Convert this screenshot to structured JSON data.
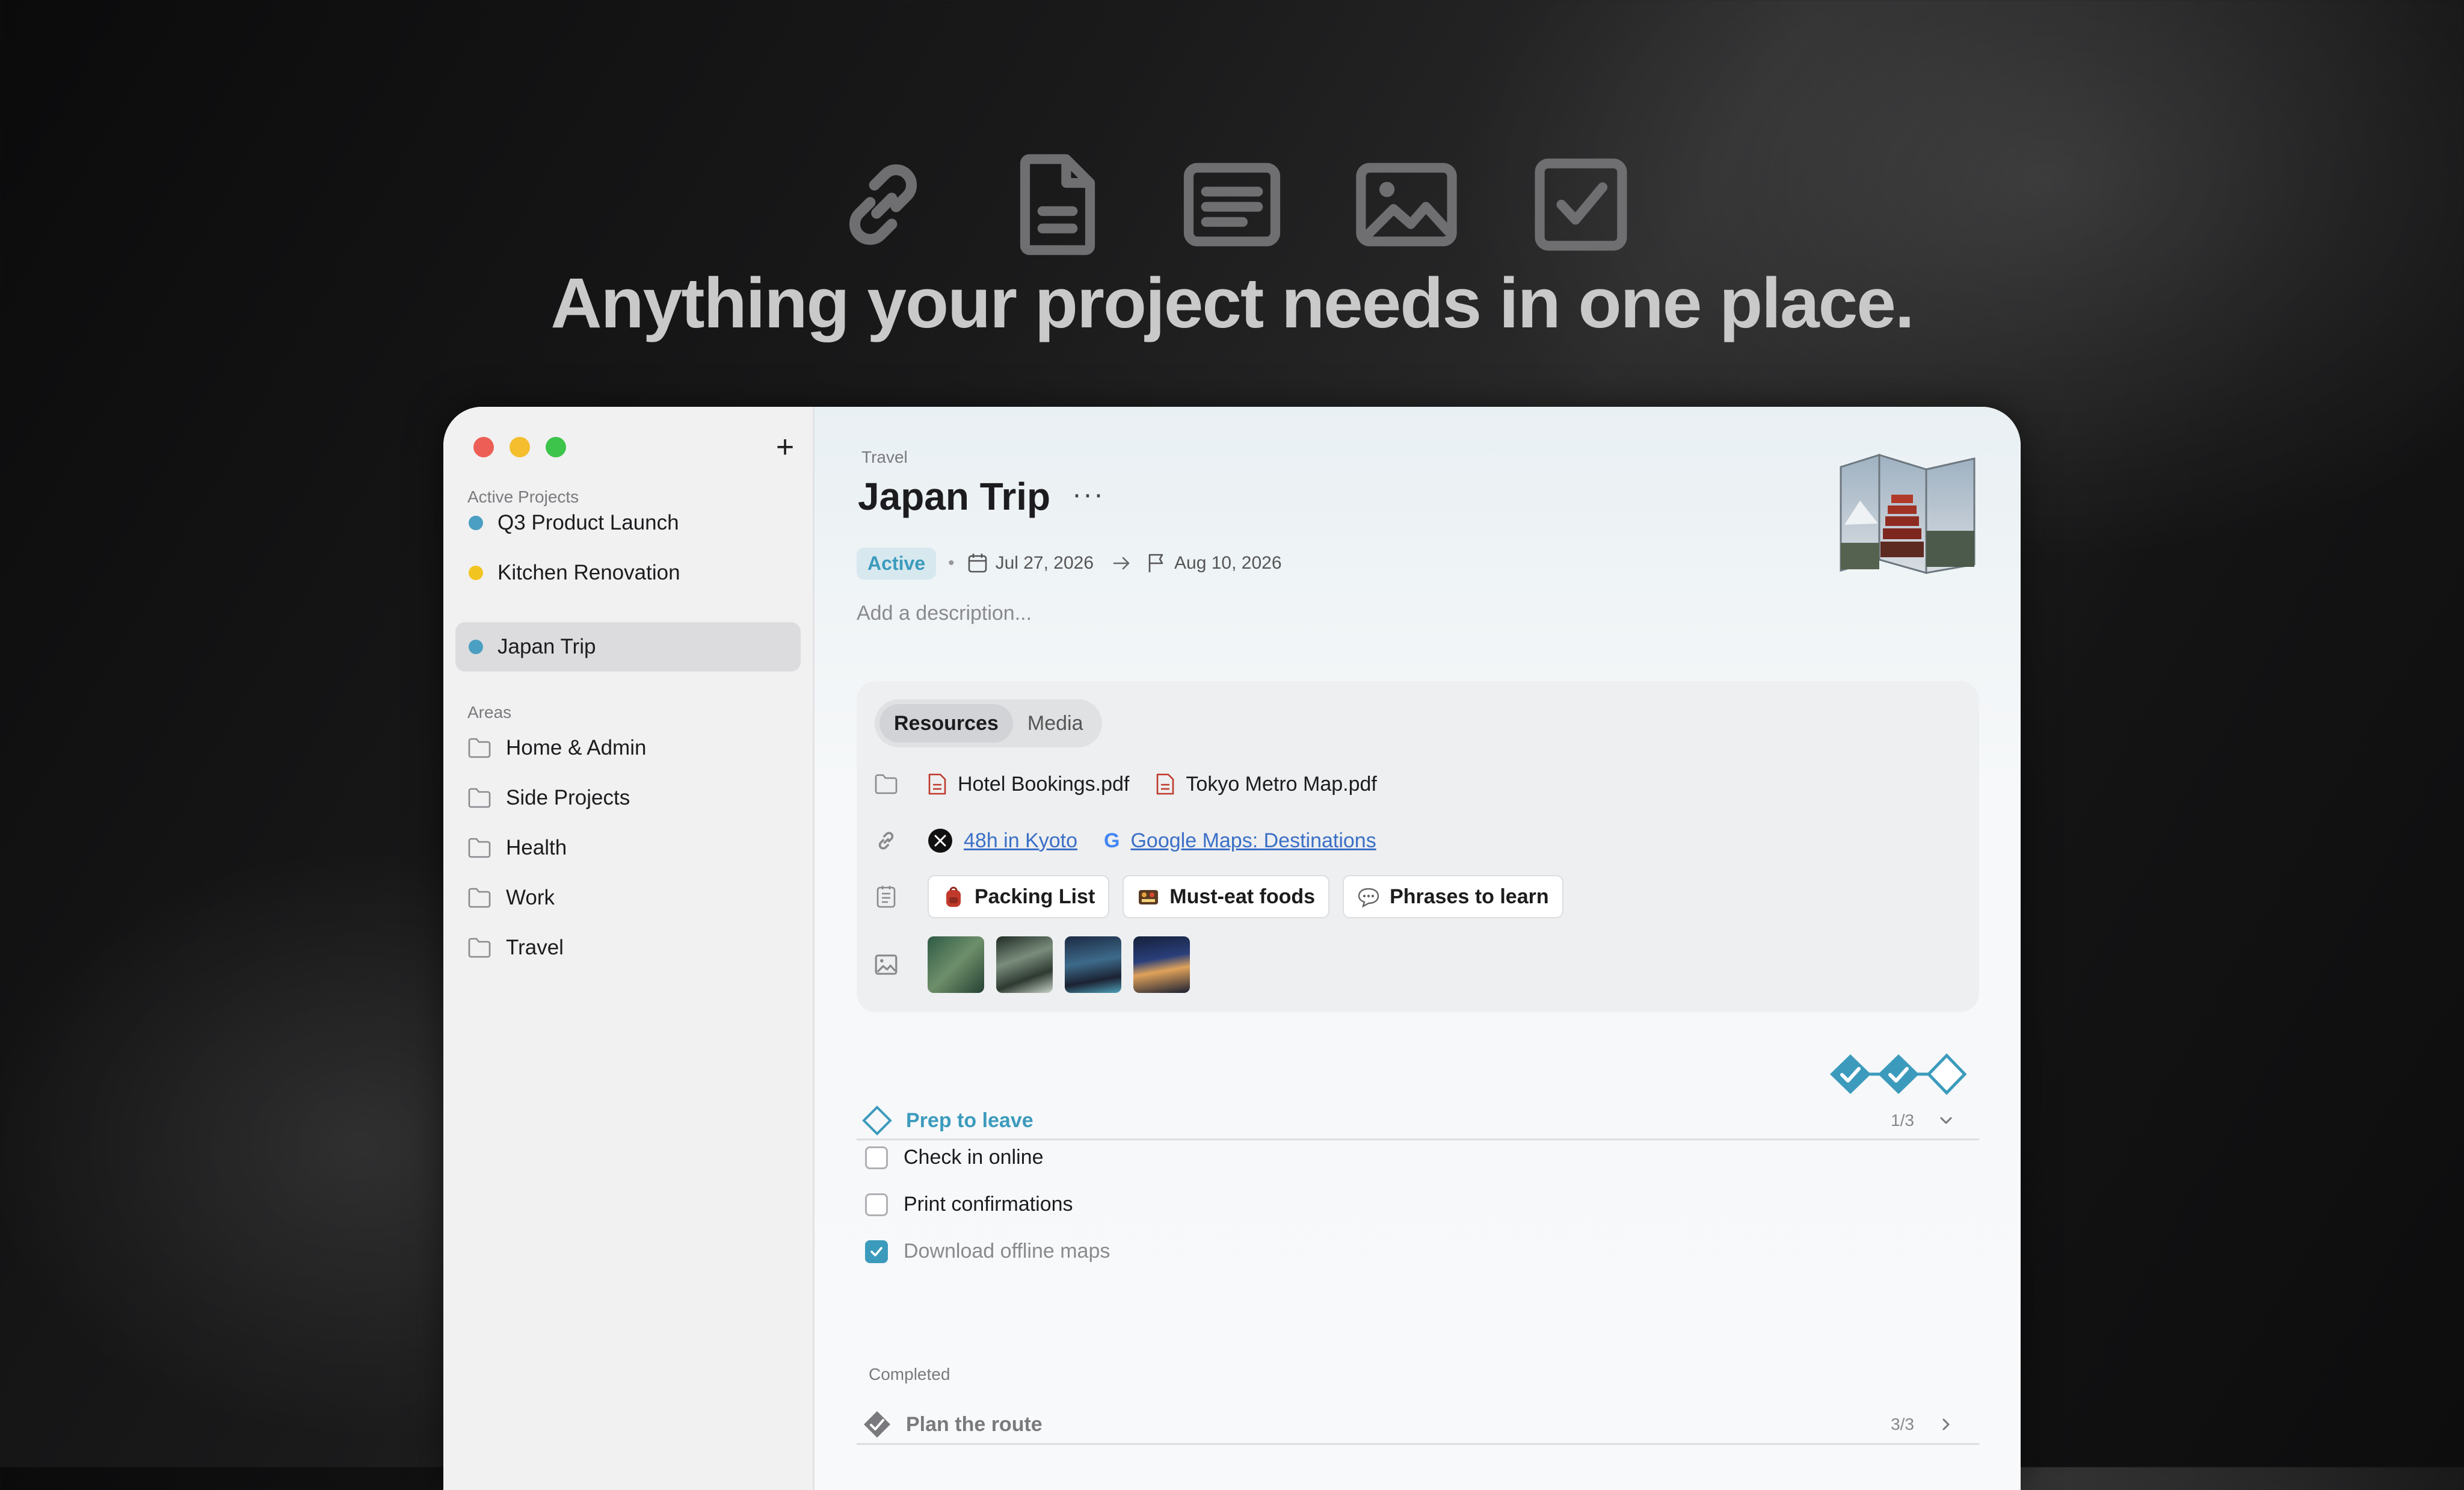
{
  "hero": {
    "icons": [
      "link-icon",
      "document-icon",
      "note-icon",
      "image-icon",
      "checkbox-icon"
    ],
    "headline": "Anything your project needs in one place."
  },
  "colors": {
    "accent": "#3c9bbd",
    "traffic_red": "#ed5f56",
    "traffic_yellow": "#f4be2e",
    "traffic_green": "#3dc44b",
    "link_blue": "#3a6fc7"
  },
  "sidebar": {
    "add_label": "+",
    "active_projects_label": "Active Projects",
    "projects": [
      {
        "label": "Q3 Product Launch",
        "color": "#4b9fc2"
      },
      {
        "label": "Kitchen Renovation",
        "color": "#f2c41f"
      },
      {
        "label": "Japan Trip",
        "color": "#4b9fc2"
      }
    ],
    "areas_label": "Areas",
    "areas": [
      "Home & Admin",
      "Side Projects",
      "Health",
      "Work",
      "Travel"
    ]
  },
  "project": {
    "breadcrumb": "Travel",
    "title": "Japan Trip",
    "more_label": "···",
    "status": "Active",
    "start_date": "Jul 27, 2026",
    "end_date": "Aug 10, 2026",
    "description_placeholder": "Add a description..."
  },
  "resources": {
    "tabs": [
      "Resources",
      "Media"
    ],
    "files": [
      "Hotel Bookings.pdf",
      "Tokyo Metro Map.pdf"
    ],
    "links": [
      "48h in Kyoto",
      "Google Maps: Destinations"
    ],
    "link_icon_letter": "G",
    "notes": [
      "Packing List",
      "Must-eat foods",
      "Phrases to learn"
    ]
  },
  "checklist": {
    "progress_steps": [
      true,
      true,
      false
    ],
    "section_title": "Prep to leave",
    "section_count": "1/3",
    "tasks": [
      {
        "label": "Check in online",
        "done": false
      },
      {
        "label": "Print confirmations",
        "done": false
      },
      {
        "label": "Download offline maps",
        "done": true
      }
    ],
    "completed_label": "Completed",
    "completed_section": {
      "title": "Plan the route",
      "count": "3/3"
    }
  }
}
